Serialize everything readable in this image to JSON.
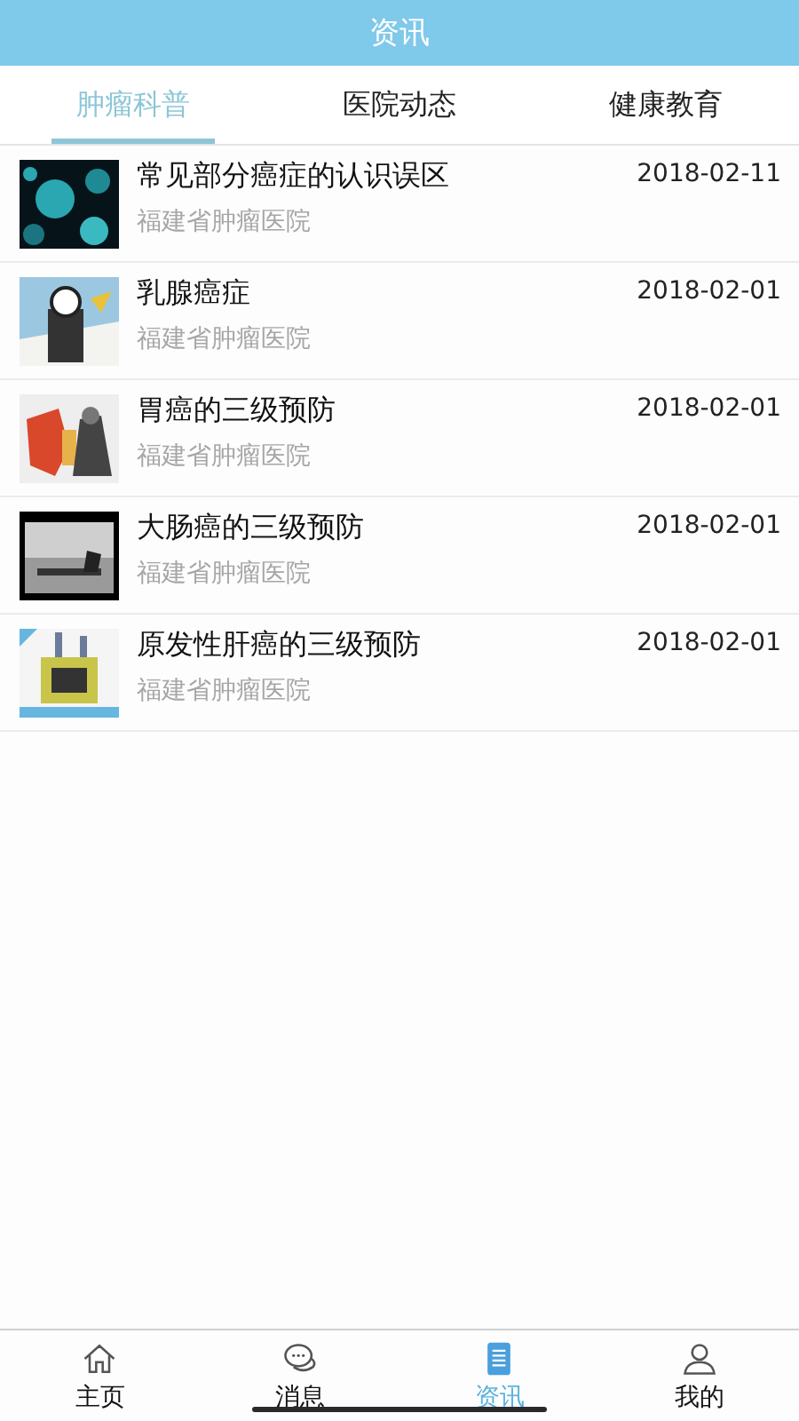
{
  "header": {
    "title": "资讯"
  },
  "tabs": [
    {
      "label": "肿瘤科普",
      "selected": true
    },
    {
      "label": "医院动态",
      "selected": false
    },
    {
      "label": "健康教育",
      "selected": false
    }
  ],
  "articles": [
    {
      "title": "常见部分癌症的认识误区",
      "source": "福建省肿瘤医院",
      "date": "2018-02-11"
    },
    {
      "title": "乳腺癌症",
      "source": "福建省肿瘤医院",
      "date": "2018-02-01"
    },
    {
      "title": "胃癌的三级预防",
      "source": "福建省肿瘤医院",
      "date": "2018-02-01"
    },
    {
      "title": "大肠癌的三级预防",
      "source": "福建省肿瘤医院",
      "date": "2018-02-01"
    },
    {
      "title": "原发性肝癌的三级预防",
      "source": "福建省肿瘤医院",
      "date": "2018-02-01"
    }
  ],
  "nav": [
    {
      "kind": "home",
      "label": "主页",
      "selected": false
    },
    {
      "kind": "chat",
      "label": "消息",
      "selected": false
    },
    {
      "kind": "news",
      "label": "资讯",
      "selected": true
    },
    {
      "kind": "profile",
      "label": "我的",
      "selected": false
    }
  ]
}
